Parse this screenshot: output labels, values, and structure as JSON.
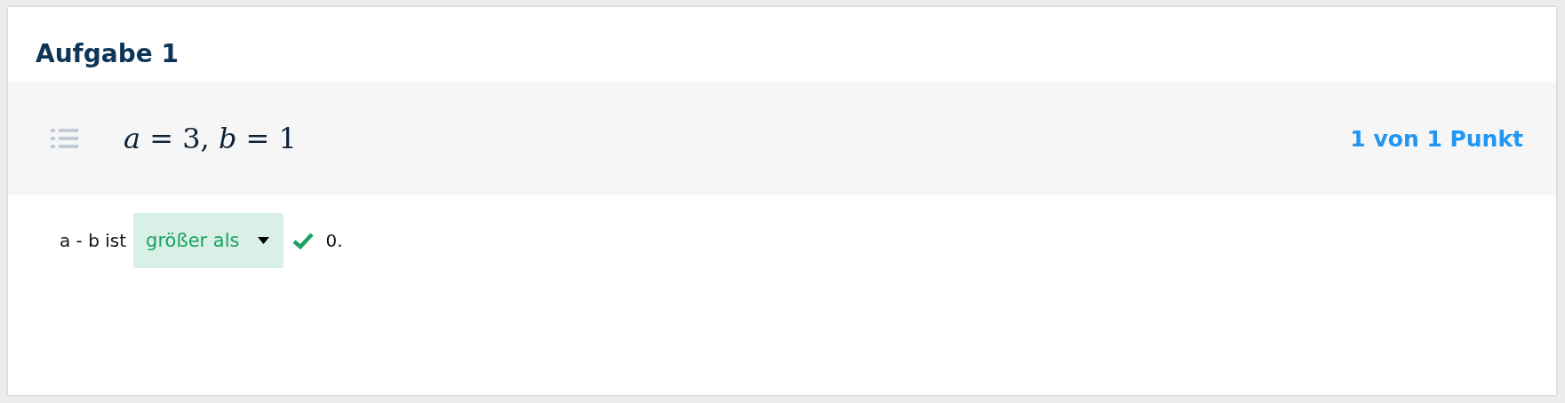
{
  "title": "Aufgabe 1",
  "statement": {
    "formula": "*a* = 3, *b* = 1",
    "score": "1 von 1 Punkt"
  },
  "answer": {
    "before": "a - b ist",
    "dropdown": {
      "value": "größer als",
      "correct": true
    },
    "after": "0."
  }
}
